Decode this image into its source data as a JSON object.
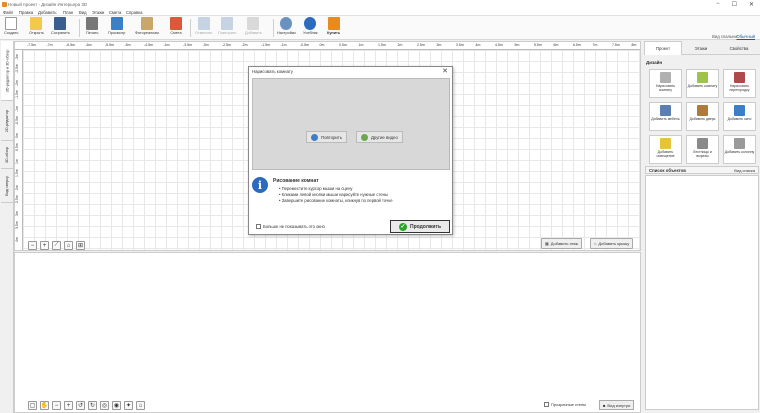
{
  "window": {
    "title": "Новый проект - Дизайн Интерьера 3D",
    "minimize": "−",
    "maximize": "☐",
    "close": "✕"
  },
  "menu": [
    "Файл",
    "Правка",
    "Добавить",
    "План",
    "Вид",
    "Этажи",
    "Смета",
    "Справка"
  ],
  "toolbar": {
    "create": "Создать",
    "open": "Открыть",
    "save": "Сохранить",
    "print": "Печать",
    "preview": "Просмотр",
    "photo": "Фотореализм",
    "estimate": "Смета",
    "undo": "Отменить",
    "redo": "Повторить",
    "add_floor": "Добавить",
    "settings": "Настройки",
    "tutorial": "Учебник",
    "buy": "Купить"
  },
  "demo": {
    "label": "Вид спальни:",
    "link": "Обычный"
  },
  "left_tabs": [
    "3D-редактор и 3D-обзор",
    "2D-редактор",
    "3D-обзор",
    "Вид сверху"
  ],
  "ruler": {
    "top": [
      "-7.5m",
      "-7m",
      "-6.5m",
      "-6m",
      "-5.5m",
      "-5m",
      "-4.5m",
      "-4m",
      "-3.5m",
      "-3m",
      "-2.5m",
      "-2m",
      "-1.5m",
      "-1m",
      "-0.5m",
      "0m",
      "0.5m",
      "1m",
      "1.5m",
      "2m",
      "2.5m",
      "3m",
      "3.5m",
      "4m",
      "4.5m",
      "5m",
      "5.5m",
      "6m",
      "6.5m",
      "7m",
      "7.5m",
      "8m"
    ],
    "left": [
      "-3m",
      "-2.5m",
      "-2m",
      "-1.5m",
      "-1m",
      "-0.5m",
      "0m",
      "0.5m",
      "1m",
      "1.5m",
      "2m",
      "2.5m",
      "3m",
      "3.5m",
      "4m"
    ]
  },
  "editor": {
    "add_floor": "Добавить этаж",
    "add_roof": "Добавить крышу"
  },
  "view3d": {
    "transparent_walls": "Прозрачные стены",
    "view_inside": "Вид изнутри"
  },
  "rpanel": {
    "tabs": [
      "Проект",
      "Этажи",
      "Свойства"
    ],
    "design_title": "Дизайн",
    "design_items": [
      "Нарисовать комнату",
      "Добавить комнату",
      "Нарисовать перегородку",
      "Добавить мебель",
      "Добавить дверь",
      "Добавить окно",
      "Добавить освещение",
      "Лестницы и вырезы",
      "Добавить колонну"
    ],
    "objects_title": "Список объектов",
    "objects_view": "Вид списка"
  },
  "dialog": {
    "title": "Нарисовать комнату",
    "close": "✕",
    "replay": "Повторить",
    "other_video": "Другие видео",
    "info_title": "Рисование комнат",
    "steps": [
      "Переместите курсор мыши на сцену",
      "Кликами левой кнопки мыши нарисуйте нужные стены",
      "Завершите рисование комнаты, кликнув по первой точке"
    ],
    "dont_show": "Больше не показывать это окно",
    "continue": "Продолжить"
  },
  "colors": {
    "accent": "#2a6bbf",
    "orange": "#e98a1e",
    "green": "#2aa52a"
  }
}
